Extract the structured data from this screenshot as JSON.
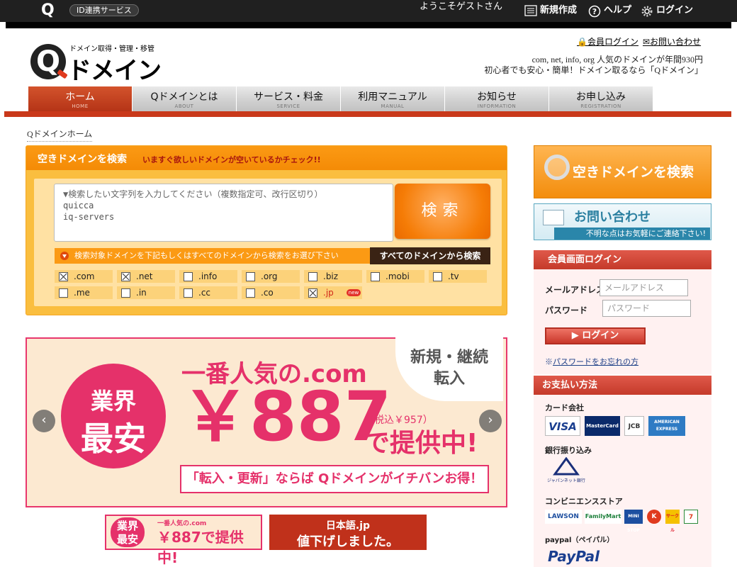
{
  "topbar": {
    "logo": "Q",
    "id_service": "ID連携サービス",
    "welcome": "ようこそゲストさん",
    "links": [
      {
        "label": "新規作成",
        "icon": "list-icon"
      },
      {
        "label": "ヘルプ",
        "icon": "help-icon"
      },
      {
        "label": "ログイン",
        "icon": "gear-icon"
      }
    ]
  },
  "header": {
    "brand_tagline": "ドメイン取得・管理・移管",
    "brand_mark": "Q",
    "brand_name": "ドメイン",
    "member_login": "会員ログイン",
    "contact": "お問い合わせ",
    "tagline1": "com, net, info, org 人気のドメインが年間930円",
    "tagline2": "初心者でも安心・簡単！ドメイン取るなら「Qドメイン」"
  },
  "nav": [
    {
      "label": "ホーム",
      "sub": "HOME",
      "active": true
    },
    {
      "label": "Qドメインとは",
      "sub": "ABOUT",
      "active": false
    },
    {
      "label": "サービス・料金",
      "sub": "SERVICE",
      "active": false
    },
    {
      "label": "利用マニュアル",
      "sub": "MANUAL",
      "active": false
    },
    {
      "label": "お知らせ",
      "sub": "INFORMATION",
      "active": false
    },
    {
      "label": "お申し込み",
      "sub": "REGISTRATION",
      "active": false
    }
  ],
  "breadcrumb": "Qドメインホーム",
  "search": {
    "title": "空きドメインを検索",
    "subtitle": "いますぐ欲しいドメインが空いているかチェック!!",
    "placeholder": "▼検索したい文字列を入力してください（複数指定可、改行区切り）",
    "lines": [
      "quicca",
      "iq-servers"
    ],
    "button": "検索",
    "instruction": "検索対象ドメインを下記もしくはすべてのドメインから検索をお選び下さい",
    "all_button": "すべてのドメインから検索",
    "new_badge": "new",
    "tlds": [
      {
        "name": ".com",
        "checked": true
      },
      {
        "name": ".net",
        "checked": true
      },
      {
        "name": ".info",
        "checked": false
      },
      {
        "name": ".org",
        "checked": false
      },
      {
        "name": ".biz",
        "checked": false
      },
      {
        "name": ".mobi",
        "checked": false
      },
      {
        "name": ".tv",
        "checked": false
      },
      {
        "name": ".me",
        "checked": false
      },
      {
        "name": ".in",
        "checked": false
      },
      {
        "name": ".cc",
        "checked": false
      },
      {
        "name": ".co",
        "checked": false
      },
      {
        "name": ".jp",
        "checked": true
      }
    ]
  },
  "banner": {
    "circle_line1": "業界",
    "circle_line2": "最安",
    "line1": "一番人気の.com",
    "price": "￥887",
    "tax": "（税込￥957）",
    "offer": "で提供中!",
    "bubble_line1": "新規・継続",
    "bubble_line2": "転入",
    "footer": "「転入・更新」ならば Qドメインがイチバンお得！",
    "prev": "‹",
    "next": "›"
  },
  "mini_banners": {
    "left_circle": "業界\n最安",
    "left_small": "一番人気の.com",
    "left_price": "￥887で提供中!",
    "right_line1": "日本語.jp",
    "right_line2": "値下げしました。"
  },
  "sidebar": {
    "search_banner": "空きドメインを検索",
    "contact_title": "お問い合わせ",
    "contact_sub": "不明な点はお気軽にご連絡下さい!",
    "login_header": "会員画面ログイン",
    "email_label": "メールアドレス",
    "email_placeholder": "メールアドレス",
    "password_label": "パスワード",
    "password_placeholder": "パスワード",
    "login_button": "ログイン",
    "forgot_prefix": "※",
    "forgot": "パスワードをお忘れの方",
    "payment_header": "お支払い方法",
    "card_title": "カード会社",
    "cards": [
      "VISA",
      "MasterCard",
      "JCB",
      "AMERICAN EXPRESS"
    ],
    "bank_title": "銀行振り込み",
    "bank": "ジャパンネット銀行",
    "cvs_title": "コンビニエンスストア",
    "cvs": [
      "LAWSON",
      "FamilyMart",
      "MINI STOP",
      "K",
      "サークル",
      "7"
    ],
    "paypal_title": "paypal（ペイパル）",
    "paypal": "PayPal"
  }
}
